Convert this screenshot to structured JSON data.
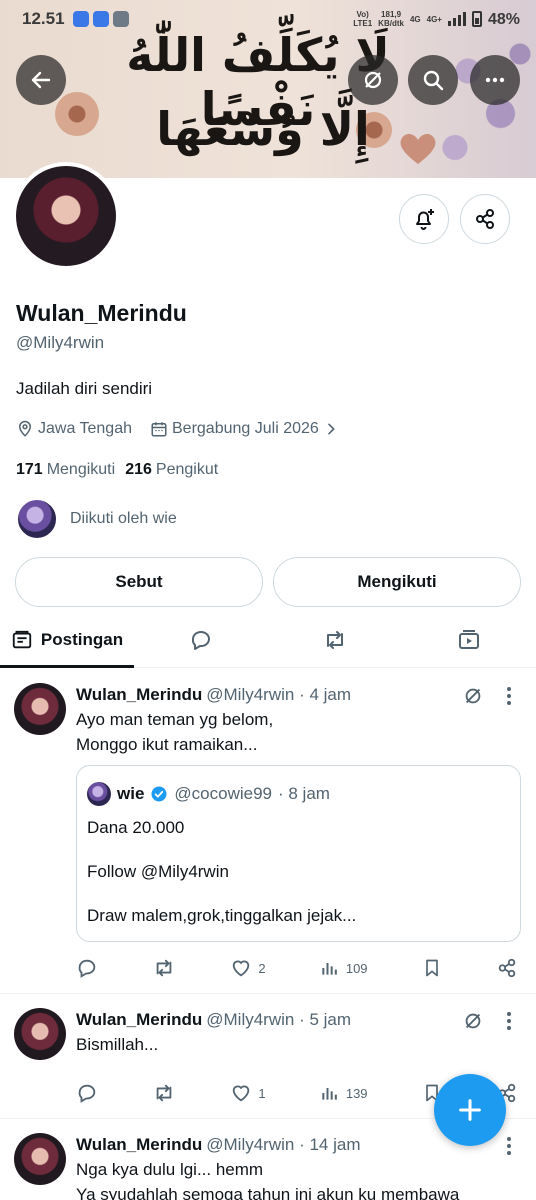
{
  "status_bar": {
    "time": "12.51",
    "net_top": "Vo)",
    "net_bottom": "LTE1",
    "speed_top": "181,9",
    "speed_bottom": "KB/dtk",
    "net2": "4G",
    "net3": "4G+",
    "battery": "48%"
  },
  "banner": {
    "line1": "لَا يُكَلِّفُ اللّٰهُ نَفْسًا",
    "line2": "إِلَّا وُسْعَهَا"
  },
  "profile": {
    "name": "Wulan_Merindu",
    "handle": "@Mily4rwin",
    "bio": "Jadilah diri sendiri",
    "location": "Jawa Tengah",
    "joined": "Bergabung Juli 2026",
    "following_count": "171",
    "following_label": "Mengikuti",
    "followers_count": "216",
    "followers_label": "Pengikut",
    "followed_by": "Diikuti oleh wie"
  },
  "buttons": {
    "mention": "Sebut",
    "following": "Mengikuti"
  },
  "tabs": [
    {
      "label": "Postingan"
    }
  ],
  "posts": [
    {
      "name": "Wulan_Merindu",
      "handle": "@Mily4rwin",
      "time": "· 4 jam",
      "line1": "Ayo man teman yg belom,",
      "line2": "Monggo ikut ramaikan...",
      "quote": {
        "name": "wie",
        "handle": "@cocowie99",
        "time": "· 8 jam",
        "l1": "Dana 20.000",
        "l2": "Follow @Mily4rwin",
        "l3": "Draw malem,grok,tinggalkan jejak..."
      },
      "likes": "2",
      "views": "109"
    },
    {
      "name": "Wulan_Merindu",
      "handle": "@Mily4rwin",
      "time": "· 5 jam",
      "line1": "Bismillah...",
      "likes": "1",
      "views": "139"
    },
    {
      "name": "Wulan_Merindu",
      "handle": "@Mily4rwin",
      "time": "· 14 jam",
      "line1": "Nga kya dulu lgi... hemm",
      "line2": "Ya syudahlah semoga tahun ini akun ku membawa"
    }
  ],
  "colors": {
    "accent": "#1d9bf0",
    "text": "#0f1419",
    "muted": "#536471",
    "border": "#cfd9de"
  }
}
